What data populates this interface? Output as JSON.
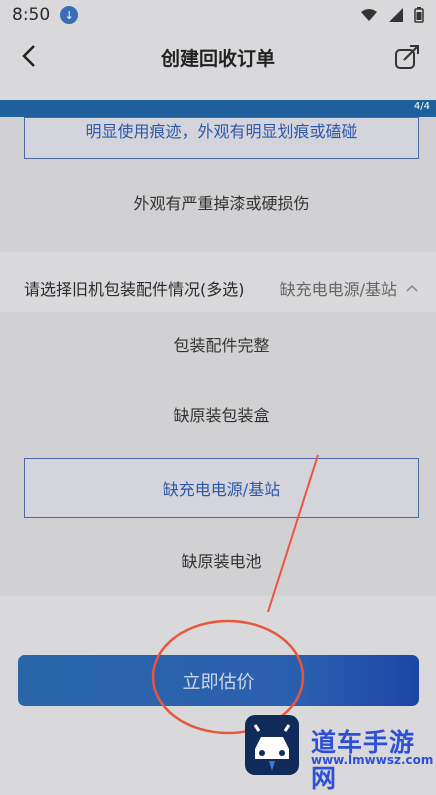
{
  "status": {
    "time": "8:50"
  },
  "nav": {
    "title": "创建回收订单"
  },
  "progress": {
    "label": "4/4",
    "fraction": 1.0
  },
  "condition_options": [
    "明显使用痕迹，外观有明显划痕或磕碰",
    "外观有严重掉漆或硬损伤"
  ],
  "accessories": {
    "question": "请选择旧机包装配件情况(多选)",
    "selected_summary": "缺充电电源/基站",
    "options": [
      "包装配件完整",
      "缺原装包装盒",
      "缺充电电源/基站",
      "缺原装电池"
    ]
  },
  "estimate_button": {
    "label": "立即估价"
  },
  "watermark": {
    "text": "道车手游网",
    "url": "www.lmwwsz.com"
  }
}
